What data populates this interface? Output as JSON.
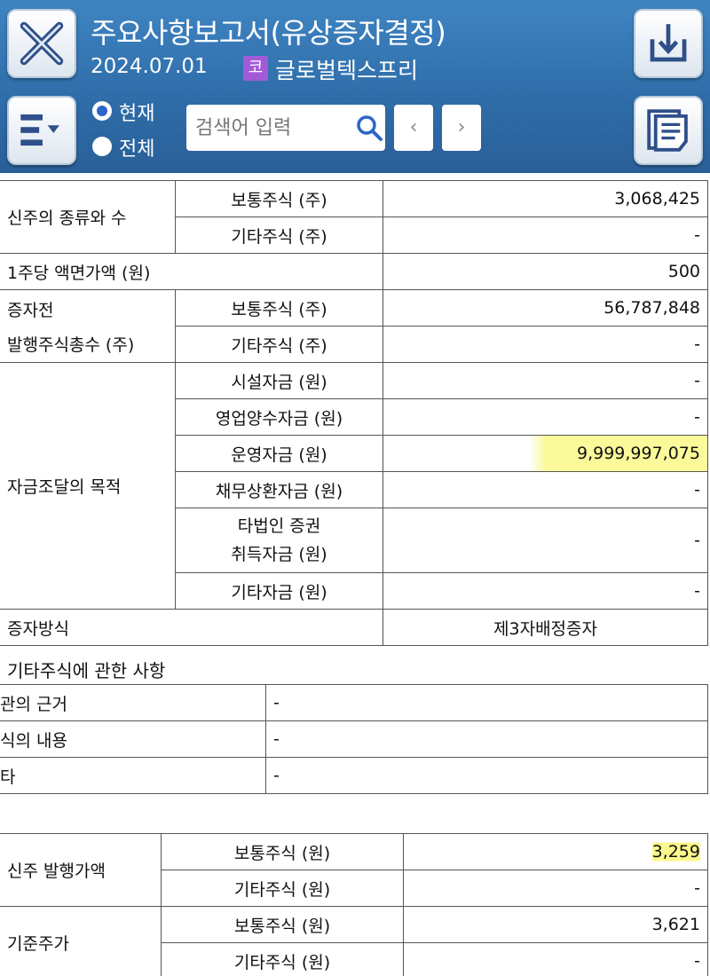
{
  "header": {
    "title": "주요사항보고서(유상증자결정)",
    "date": "2024.07.01",
    "market_badge": "코",
    "company": "글로벌텍스프리",
    "radio_current": "현재",
    "radio_all": "전체",
    "radio_selected": "현재",
    "search_placeholder": "검색어 입력",
    "prev": "‹",
    "next": "›",
    "icons": [
      "close-icon",
      "menu-icon",
      "download-icon",
      "document-icon",
      "search-icon"
    ],
    "colors": {
      "header_bg": "#2f6eaa",
      "badge": "#a35ad8",
      "highlight": "#fbf88c"
    }
  },
  "table1": {
    "new_shares_label": "신주의 종류와 수",
    "common_shares_label": "보통주식 (주)",
    "common_shares_value": "3,068,425",
    "other_shares_label": "기타주식 (주)",
    "other_shares_value": "-",
    "par_value_label": "1주당 액면가액 (원)",
    "par_value": "500",
    "pre_total_label_1": "증자전",
    "pre_total_label_2": "발행주식총수 (주)",
    "pre_common_label": "보통주식 (주)",
    "pre_common_value": "56,787,848",
    "pre_other_label": "기타주식 (주)",
    "pre_other_value": "-",
    "purpose_label": "자금조달의 목적",
    "facility_label": "시설자금 (원)",
    "facility_value": "-",
    "acquisition_label": "영업양수자금 (원)",
    "acquisition_value": "-",
    "operating_label": "운영자금 (원)",
    "operating_value": "9,999,997,075",
    "debt_label": "채무상환자금 (원)",
    "debt_value": "-",
    "other_sec_label_1": "타법인 증권",
    "other_sec_label_2": "취득자금 (원)",
    "other_sec_value": "-",
    "other_fund_label": "기타자금 (원)",
    "other_fund_value": "-",
    "method_label": "증자방식",
    "method_value": "제3자배정증자"
  },
  "section2": {
    "title": "기타주식에 관한 사항",
    "rows": [
      {
        "label": "관의 근거",
        "value": "-"
      },
      {
        "label": "식의 내용",
        "value": "-"
      },
      {
        "label": "타",
        "value": "-"
      }
    ]
  },
  "table3": {
    "issue_price_label": "신주 발행가액",
    "common_label": "보통주식 (원)",
    "common_value": "3,259",
    "other_label": "기타주식 (원)",
    "other_value": "-",
    "base_price_label": "기준주가",
    "base_common_label": "보통주식 (원)",
    "base_common_value": "3,621",
    "base_other_label": "기타주식 (원)",
    "base_other_value": "-"
  }
}
